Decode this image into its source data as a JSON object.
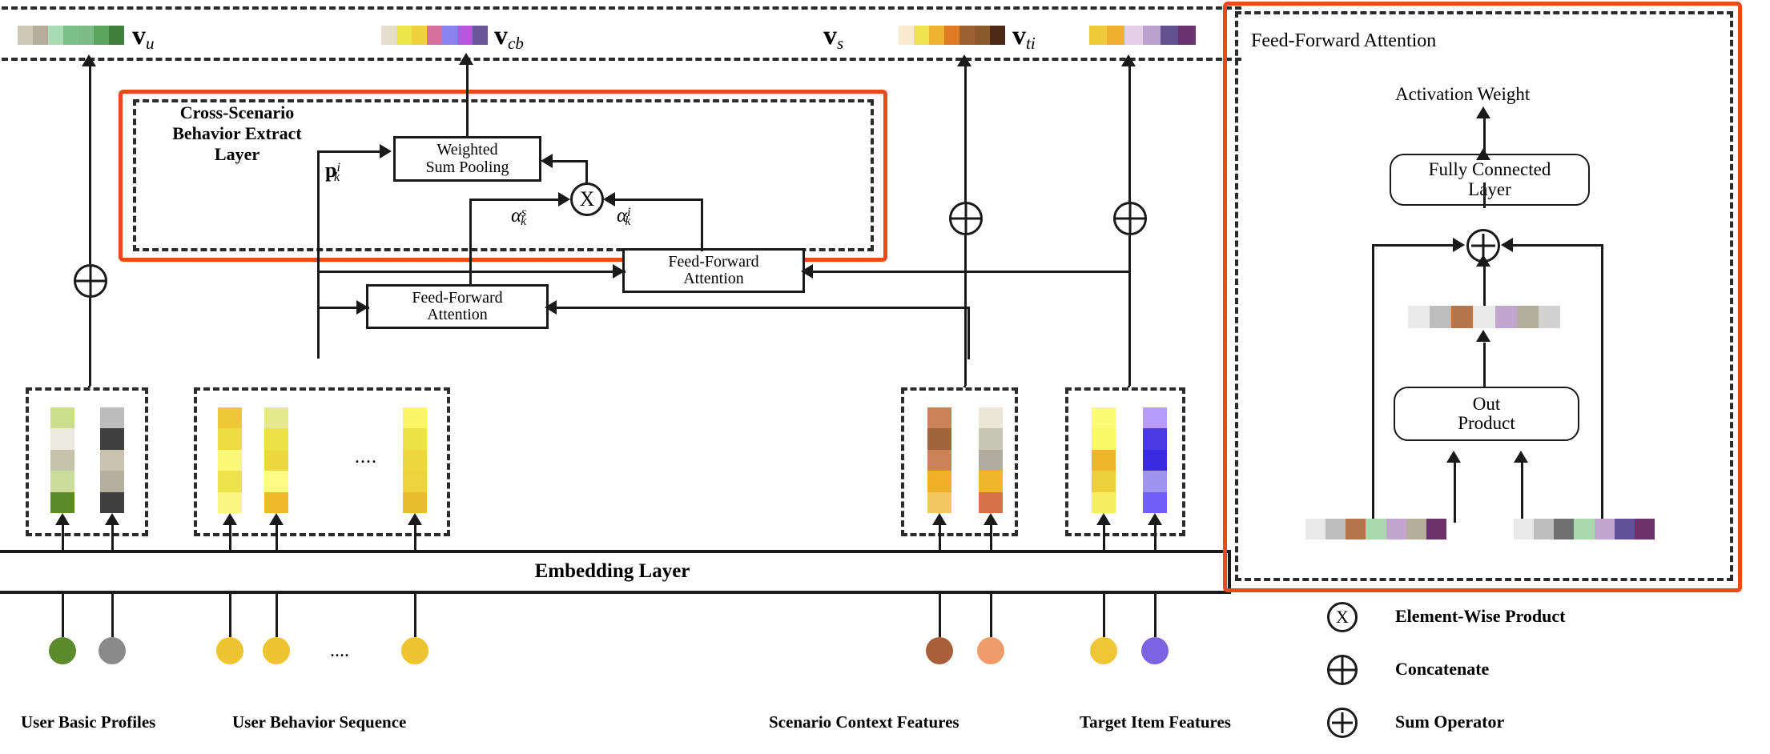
{
  "figure": {
    "title": "Cross-Scenario Behavior Extraction Network Architecture",
    "accent_color": "#e8491e",
    "line_color": "#1a1a1a"
  },
  "top_vectors": [
    {
      "name": "v_u",
      "label_main": "v",
      "label_sub": "u",
      "colors": [
        "#cdc8b4",
        "#b4ac9f",
        "#a9dcb4",
        "#7dc08c",
        "#7cbb86",
        "#5ba45e",
        "#3f7f3e"
      ]
    },
    {
      "name": "v_cb",
      "label_main": "v",
      "label_sub": "cb",
      "colors": [
        "#e6ddd0",
        "#ece54c",
        "#efd13e",
        "#d8709f",
        "#8a84ee",
        "#b558db",
        "#6b5697"
      ]
    },
    {
      "name": "v_s",
      "label_main": "v",
      "label_sub": "s",
      "colors": [
        "#f8e9cf",
        "#eee44f",
        "#eeb130",
        "#df7b24",
        "#9c6131",
        "#8a5a2b",
        "#4d2a17"
      ]
    },
    {
      "name": "v_ti",
      "label_main": "v",
      "label_sub": "ti",
      "colors": [
        "#efcb3b",
        "#efb02f",
        "#e4cde6",
        "#b9a3cd",
        "#64518f",
        "#6b3470"
      ]
    }
  ],
  "cross_scenario": {
    "title_lines": [
      "Cross-Scenario",
      "Behavior Extract",
      "Layer"
    ],
    "weighted_sum_pooling": "Weighted\nSum Pooling",
    "weighted_sum_pooling_l1": "Weighted",
    "weighted_sum_pooling_l2": "Sum Pooling",
    "ffa_left_l1": "Feed-Forward",
    "ffa_left_l2": "Attention",
    "ffa_right_l1": "Feed-Forward",
    "ffa_right_l2": "Attention",
    "p_symbol": {
      "base": "p",
      "sup": "i",
      "sub": "k"
    },
    "alpha_s": {
      "base": "α",
      "sup": "s",
      "sub": "k"
    },
    "alpha_i": {
      "base": "α",
      "sup": "i",
      "sub": "k"
    },
    "product_glyph": "X"
  },
  "embedding_layer": {
    "label": "Embedding Layer"
  },
  "bottom_labels": [
    {
      "name": "user-basic-profiles",
      "text": "User Basic Profiles"
    },
    {
      "name": "user-behavior-sequence",
      "text": "User Behavior Sequence"
    },
    {
      "name": "scenario-context-features",
      "text": "Scenario Context Features"
    },
    {
      "name": "target-item-features",
      "text": "Target Item Features"
    }
  ],
  "ellipsis": "....",
  "feature_groups": [
    {
      "name": "user-basic-profiles",
      "columns": [
        {
          "colors": [
            "#cbdd8e",
            "#eceade",
            "#c6c3ac",
            "#c9dc9a",
            "#5d8a2b"
          ],
          "dot": "#5d8a2b"
        },
        {
          "colors": [
            "#bcbcbc",
            "#3f3f3f",
            "#c8c2ae",
            "#b4b0a0",
            "#3f3f3f"
          ],
          "dot": "#8a8a8a"
        }
      ]
    },
    {
      "name": "user-behavior-sequence",
      "columns": [
        {
          "colors": [
            "#edc93a",
            "#eddd43",
            "#fbf779",
            "#ece34d",
            "#fbf584"
          ],
          "dot": "#eec430"
        },
        {
          "colors": [
            "#e5e88c",
            "#ece248",
            "#ecd83f",
            "#fdfb83",
            "#efb92c"
          ],
          "dot": "#eec430"
        },
        {
          "colors": [
            "#fbf668",
            "#ece245",
            "#ecd73c",
            "#edd33f",
            "#e8bc2e"
          ],
          "dot": "#eec430"
        }
      ]
    },
    {
      "name": "scenario-context-features",
      "columns": [
        {
          "colors": [
            "#cb8257",
            "#a2643c",
            "#cb8257",
            "#f0b02a",
            "#f2c762"
          ],
          "dot": "#a9603a"
        },
        {
          "colors": [
            "#ece6d6",
            "#c8c6b4",
            "#b0ada0",
            "#efb52b",
            "#d6714a"
          ],
          "dot": "#ef9b6a"
        }
      ]
    },
    {
      "name": "target-item-features",
      "columns": [
        {
          "colors": [
            "#fbfb74",
            "#fbf868",
            "#efb62c",
            "#ecd03b",
            "#f4ee60"
          ],
          "dot": "#efc736"
        },
        {
          "colors": [
            "#b79cfb",
            "#4a3ae6",
            "#3a2ae0",
            "#a093ef",
            "#6f5ff7"
          ],
          "dot": "#7b63e3"
        }
      ]
    }
  ],
  "ffa_panel": {
    "title": "Feed-Forward Attention",
    "activation_weight": "Activation Weight",
    "fully_connected_l1": "Fully Connected",
    "fully_connected_l2": "Layer",
    "out_product_l1": "Out",
    "out_product_l2": "Product",
    "mid_vector_colors": [
      "#e9e9e9",
      "#bdbdbd",
      "#b4764a",
      "#e9e9e9",
      "#c3a6cd",
      "#b4ae9d",
      "#d2d2d2"
    ],
    "input_left_colors": [
      "#e9e9e9",
      "#bdbdbd",
      "#b4764a",
      "#a9d9ad",
      "#c3a6cd",
      "#b4ae9d",
      "#6d3368"
    ],
    "input_right_colors": [
      "#e9e9e9",
      "#bdbdbd",
      "#6f6f6f",
      "#a9d9ad",
      "#c3a6cd",
      "#61519a",
      "#6d3368"
    ]
  },
  "legend": [
    {
      "icon": "circle-x-icon",
      "label": "Element-Wise Product"
    },
    {
      "icon": "circle-plus-cross-icon",
      "label": "Concatenate"
    },
    {
      "icon": "circle-plus-icon",
      "label": "Sum Operator"
    }
  ]
}
